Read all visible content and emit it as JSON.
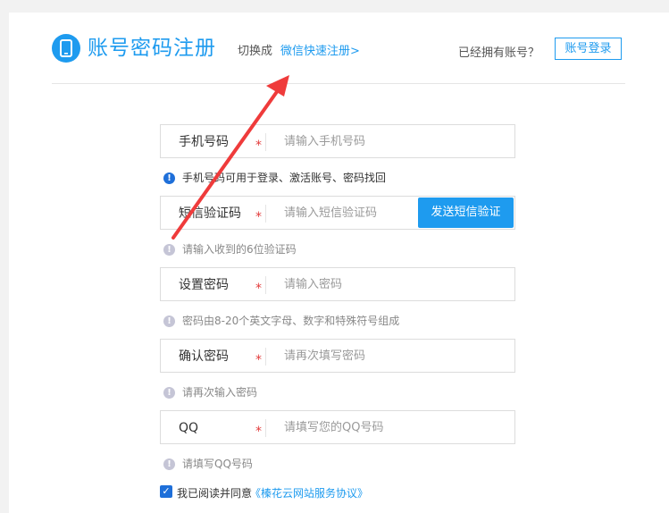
{
  "header": {
    "title": "账号密码注册",
    "switch_prefix": "切换成",
    "switch_link": "微信快速注册>",
    "have_account": "已经拥有账号？",
    "login_button": "账号登录"
  },
  "fields": [
    {
      "label": "手机号码",
      "required": "*",
      "placeholder": "请输入手机号码",
      "hint": "手机号码可用于登录、激活账号、密码找回",
      "hint_icon": "!"
    },
    {
      "label": "短信验证码",
      "required": "*",
      "placeholder": "请输入短信验证码",
      "button": "发送短信验证",
      "hint": "请输入收到的6位验证码",
      "hint_icon": "!"
    },
    {
      "label": "设置密码",
      "required": "*",
      "placeholder": "请输入密码",
      "hint": "密码由8-20个英文字母、数字和特殊符号组成",
      "hint_icon": "!"
    },
    {
      "label": "确认密码",
      "required": "*",
      "placeholder": "请再次填写密码",
      "hint": "请再次输入密码",
      "hint_icon": "!"
    },
    {
      "label": "QQ",
      "required": "*",
      "placeholder": "请填写您的QQ号码",
      "hint": "请填写QQ号码",
      "hint_icon": "!"
    }
  ],
  "agreement": {
    "checked": "✓",
    "text": "我已阅读并同意",
    "link": "《榛花云网站服务协议》"
  },
  "colors": {
    "accent": "#1e9bef",
    "required": "#e23b3b",
    "annotation_arrow": "#ef3b3b"
  }
}
